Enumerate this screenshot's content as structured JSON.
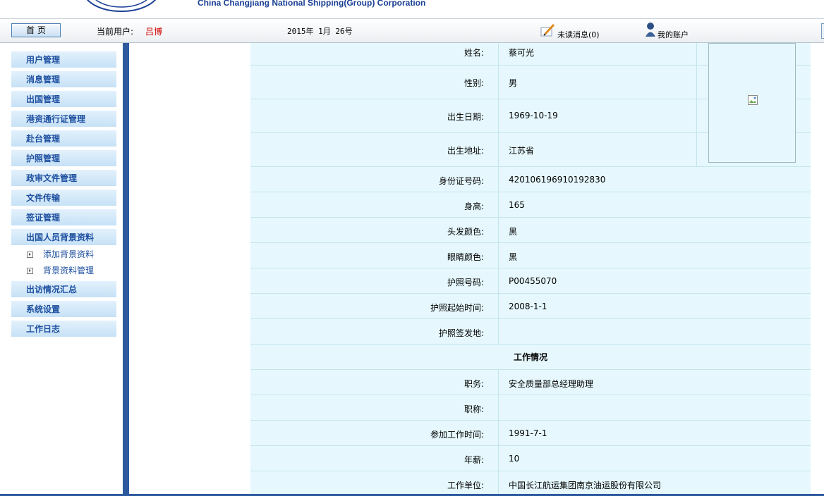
{
  "header": {
    "company_name": "China Changjiang National Shipping(Group) Corporation"
  },
  "toolbar": {
    "home_label": "首 页",
    "current_user_label": "当前用户:",
    "current_user_name": "吕博",
    "date": "2015年 1月 26号",
    "unread_messages": "未读消息(0)",
    "my_account": "我的账户"
  },
  "sidebar": {
    "items": [
      "用户管理",
      "消息管理",
      "出国管理",
      "港资通行证管理",
      "赴台管理",
      "护照管理",
      "政审文件管理",
      "文件传输",
      "签证管理",
      "出国人员背景资料"
    ],
    "sub_items": [
      "添加背景资料",
      "背景资料管理"
    ],
    "items_after": [
      "出访情况汇总",
      "系统设置",
      "工作日志"
    ]
  },
  "profile": {
    "rows": [
      {
        "label": "姓名:",
        "value": "蔡可光"
      },
      {
        "label": "性别:",
        "value": "男"
      },
      {
        "label": "出生日期:",
        "value": "1969-10-19"
      },
      {
        "label": "出生地址:",
        "value": "江苏省"
      },
      {
        "label": "身份证号码:",
        "value": "420106196910192830"
      },
      {
        "label": "身高:",
        "value": "165"
      },
      {
        "label": "头发颜色:",
        "value": "黑"
      },
      {
        "label": "眼睛颜色:",
        "value": "黑"
      },
      {
        "label": "护照号码:",
        "value": "P00455070"
      },
      {
        "label": "护照起始时间:",
        "value": "2008-1-1"
      },
      {
        "label": "护照签发地:",
        "value": ""
      }
    ],
    "work_section_title": "工作情况",
    "work_rows": [
      {
        "label": "职务:",
        "value": "安全质量部总经理助理"
      },
      {
        "label": "职称:",
        "value": ""
      },
      {
        "label": "参加工作时间:",
        "value": "1991-7-1"
      },
      {
        "label": "年薪:",
        "value": "10"
      },
      {
        "label": "工作单位:",
        "value": "中国长江航运集团南京油运股份有限公司"
      }
    ]
  }
}
